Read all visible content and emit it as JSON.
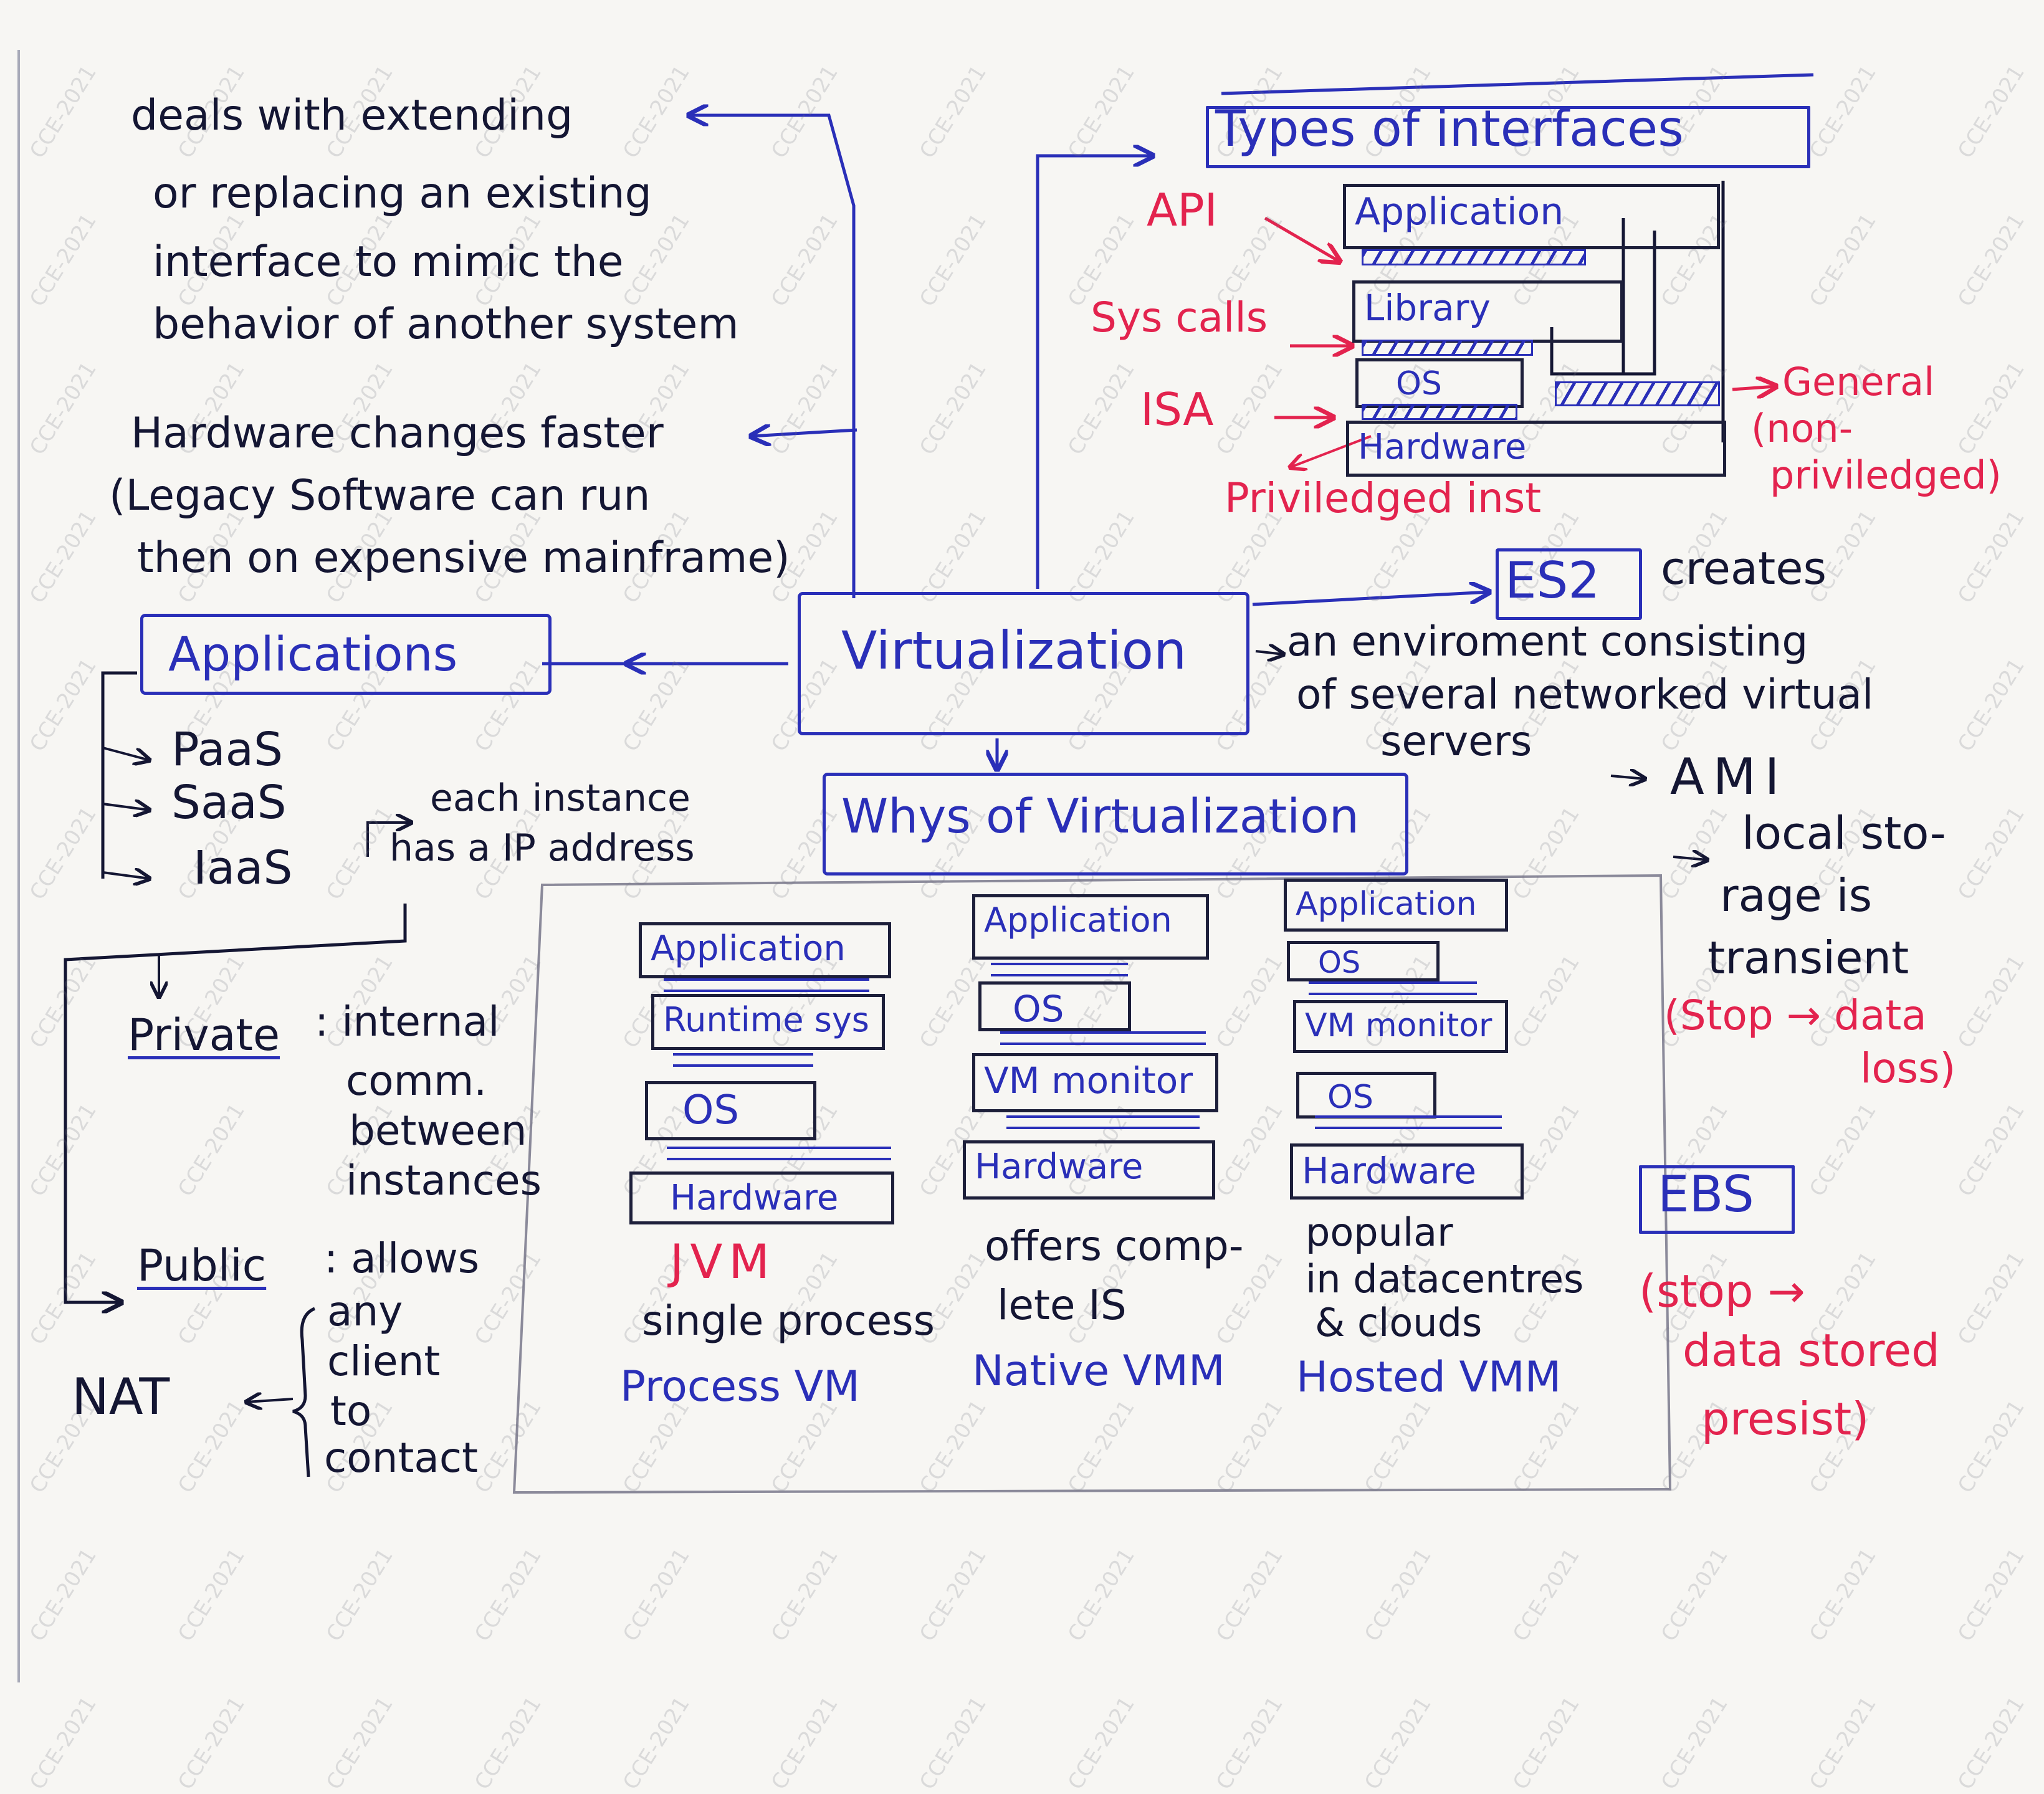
{
  "watermark": "CCE-2021",
  "colors": {
    "ink": "#141633",
    "blue": "#2a2fb8",
    "red": "#e3234e",
    "paper": "#f7f6f3"
  },
  "left": {
    "definition": [
      "deals with extending",
      "or replacing an existing",
      "interface to mimic the",
      "behavior of another system"
    ],
    "hardware_note": [
      "Hardware changes faster",
      "(Legacy Software can run",
      "then on expensive mainframe)"
    ],
    "applications_title": "Applications",
    "app_types": [
      "PaaS",
      "SaaS",
      "IaaS"
    ],
    "instance_note": [
      "each instance",
      "has a IP address"
    ],
    "private_label": "Private",
    "private_desc": [
      ": internal",
      "comm.",
      "between",
      "instances"
    ],
    "public_label": "Public",
    "public_desc": [
      ": allows",
      "any",
      "client",
      "to",
      "contact"
    ],
    "nat_label": "NAT"
  },
  "center": {
    "virtualization": "Virtualization",
    "whys": "Whys of Virtualization"
  },
  "interfaces": {
    "title": "Types of interfaces",
    "layers": [
      "Application",
      "Library",
      "OS",
      "Hardware"
    ],
    "api_label": "API",
    "syscalls_label": "Sys calls",
    "isa_label": "ISA",
    "general_label": [
      "General",
      "(non-",
      "priviledged)"
    ],
    "privileged_label": "Priviledged inst"
  },
  "es2": {
    "title": "ES2",
    "creates": "creates",
    "desc": [
      "an enviroment consisting",
      "of several networked virtual",
      "servers"
    ],
    "ami": "AMI",
    "local_storage": [
      "local sto-",
      "rage is",
      "transient"
    ],
    "local_note": [
      "(Stop → data",
      "loss)"
    ],
    "ebs": "EBS",
    "ebs_note": [
      "(stop →",
      "data stored",
      "presist)"
    ]
  },
  "vm_types": [
    {
      "layers": [
        "Application",
        "Runtime sys",
        "OS",
        "Hardware"
      ],
      "tag": "JVM",
      "desc": [
        "single process"
      ],
      "type": "Process VM"
    },
    {
      "layers": [
        "Application",
        "OS",
        "VM monitor",
        "Hardware"
      ],
      "tag": "",
      "desc": [
        "offers comp-",
        "lete IS"
      ],
      "type": "Native VMM"
    },
    {
      "layers": [
        "Application",
        "OS",
        "VM monitor",
        "OS",
        "Hardware"
      ],
      "tag": "",
      "desc": [
        "popular",
        "in datacentres",
        "& clouds"
      ],
      "type": "Hosted VMM"
    }
  ]
}
